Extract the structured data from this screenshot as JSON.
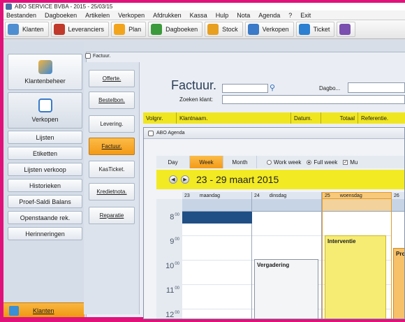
{
  "window": {
    "title": "ABO SERVICE BVBA - 2015 - 25/03/15"
  },
  "menu": [
    "Bestanden",
    "Dagboeken",
    "Artikelen",
    "Verkopen",
    "Afdrukken",
    "Kassa",
    "Hulp",
    "Nota",
    "Agenda",
    "?",
    "Exit"
  ],
  "toolbar": [
    {
      "label": "Klanten",
      "icon": "people-icon",
      "color": "#4f8fd1"
    },
    {
      "label": "Leveranciers",
      "icon": "truck-icon",
      "color": "#c0392b"
    },
    {
      "label": "Plan",
      "icon": "plan-icon",
      "color": "#f2a51c"
    },
    {
      "label": "Dagboeken",
      "icon": "books-icon",
      "color": "#3c9a3c"
    },
    {
      "label": "Stock",
      "icon": "boxes-icon",
      "color": "#e8a020"
    },
    {
      "label": "Verkopen",
      "icon": "document-icon",
      "color": "#3a7ac8"
    },
    {
      "label": "Ticket",
      "icon": "ticket-icon",
      "color": "#2c7fd1"
    },
    {
      "label": "",
      "icon": "tools-icon",
      "color": "#7a4fb0"
    }
  ],
  "left_nav": {
    "klantenbeheer": {
      "label": "Klantenbeheer",
      "icon": "customer-management-icon"
    },
    "verkopen": {
      "label": "Verkopen",
      "icon": "invoice-icon"
    },
    "items": [
      "Lijsten",
      "Etiketten",
      "Lijsten verkoop",
      "Historieken",
      "Proef-Saldi Balans",
      "Openstaande rek.",
      "Herinneringen"
    ],
    "bottom": {
      "label": "Klanten",
      "icon": "customers-icon"
    }
  },
  "content": {
    "title": "Factuur."
  },
  "doc_nav": [
    {
      "label": "Offerte.",
      "active": false
    },
    {
      "label": "Bestelbon.",
      "active": false
    },
    {
      "label": "Levering.",
      "active": false
    },
    {
      "label": "Factuur.",
      "active": true
    },
    {
      "label": "KasTicket.",
      "active": false
    },
    {
      "label": "Kredietnota.",
      "active": false
    },
    {
      "label": "Reparatie",
      "active": false
    }
  ],
  "invoice": {
    "heading": "Factuur.",
    "zoeken_label": "Zoeken klant:",
    "dagbo_label": "Dagbo...",
    "columns": [
      "Volgnr.",
      "Klantnaam.",
      "Datum.",
      "Totaal",
      "Referentie."
    ],
    "header_color": "#f0e620"
  },
  "agenda": {
    "title": "ABO Agenda",
    "views": [
      {
        "label": "Day",
        "active": false
      },
      {
        "label": "Week",
        "active": true
      },
      {
        "label": "Month",
        "active": false
      }
    ],
    "options": {
      "work_week": "Work week",
      "full_week": "Full week",
      "mu": "Mu"
    },
    "date_range": "23 - 29 maart 2015",
    "days": [
      {
        "num": "23",
        "name": "maandag",
        "today": false
      },
      {
        "num": "24",
        "name": "dinsdag",
        "today": false
      },
      {
        "num": "25",
        "name": "woensdag",
        "today": true
      },
      {
        "num": "26",
        "name": "",
        "today": false
      }
    ],
    "times": [
      {
        "h": "8",
        "m": "00"
      },
      {
        "h": "9",
        "m": "00"
      },
      {
        "h": "10",
        "m": "00"
      },
      {
        "h": "11",
        "m": "00"
      },
      {
        "h": "12",
        "m": "00"
      }
    ],
    "appointments": {
      "vergadering": "Vergadering",
      "interventie": "Interventie",
      "pro": "Pro"
    }
  }
}
